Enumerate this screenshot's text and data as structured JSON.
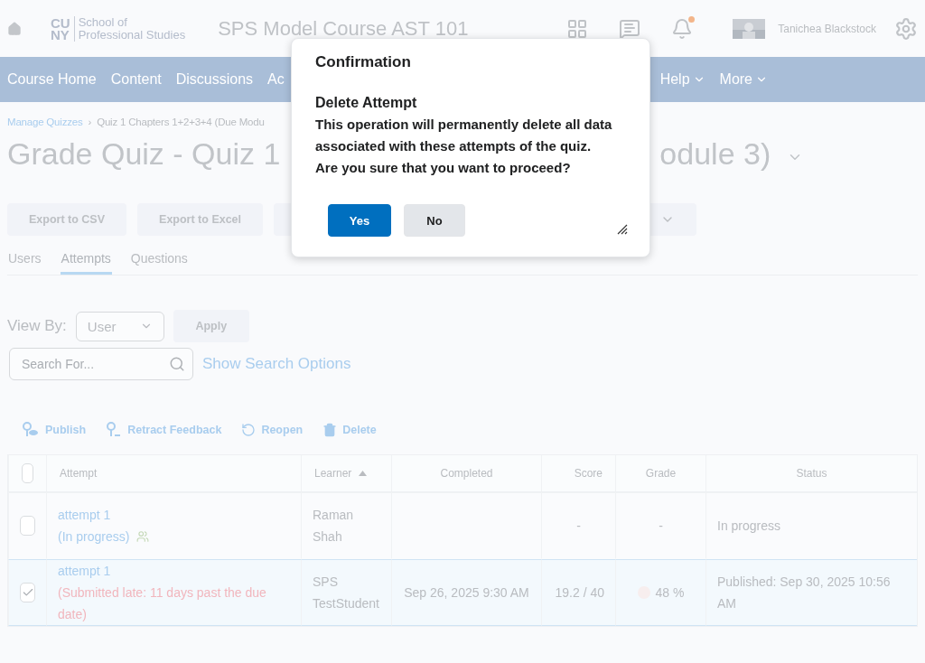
{
  "header": {
    "logo_mark_top": "CU",
    "logo_mark_bottom": "NY",
    "logo_line_1": "School of",
    "logo_line_2": "Professional Studies",
    "course_title": "SPS Model Course AST 101",
    "notification_dot": true,
    "user_name": "Tanichea Blackstock"
  },
  "nav": {
    "left_items": [
      {
        "label": "Course Home"
      },
      {
        "label": "Content"
      },
      {
        "label": "Discussions"
      },
      {
        "label": "Ac"
      }
    ],
    "right_items": [
      {
        "label": "Help",
        "has_menu": true
      },
      {
        "label": "More",
        "has_menu": true
      }
    ]
  },
  "breadcrumb": {
    "link": "Manage Quizzes",
    "separator": "›",
    "current": "Quiz 1 Chapters 1+2+3+4 (Due Modu"
  },
  "title": {
    "left": "Grade Quiz - Quiz 1",
    "right": "odule 3)"
  },
  "toolbar_buttons": [
    {
      "label": "Export to CSV",
      "kind": "text"
    },
    {
      "label": "Export to Excel",
      "kind": "text"
    },
    {
      "kind": "menu"
    }
  ],
  "tabs": [
    {
      "label": "Users",
      "selected": false
    },
    {
      "label": "Attempts",
      "selected": true
    },
    {
      "label": "Questions",
      "selected": false
    }
  ],
  "view_by": {
    "label": "View By:",
    "value": "User",
    "apply": "Apply"
  },
  "search": {
    "placeholder": "Search For...",
    "options_link": "Show Search Options"
  },
  "actions": [
    {
      "label": "Publish",
      "kind": "publish"
    },
    {
      "label": "Retract Feedback",
      "kind": "retract"
    },
    {
      "label": "Reopen",
      "kind": "reopen"
    },
    {
      "label": "Delete",
      "kind": "delete"
    }
  ],
  "table": {
    "select_all_checked": false,
    "columns": [
      {
        "label": "Attempt",
        "sorted": false
      },
      {
        "label": "Learner",
        "sorted": true
      },
      {
        "label": "Completed",
        "sorted": false
      },
      {
        "label": "Score",
        "sorted": false
      },
      {
        "label": "Grade",
        "sorted": false
      },
      {
        "label": "Status",
        "sorted": false
      }
    ],
    "rows": [
      {
        "selected": false,
        "checked": false,
        "attempt": "attempt 1",
        "note": "(In progress)",
        "late": false,
        "learner": "Raman Shah",
        "score": "-",
        "grade": "-",
        "grade_icon": false,
        "status": "In progress"
      },
      {
        "selected": true,
        "checked": true,
        "attempt": "attempt 1",
        "note": "(Submitted late: 11 days past the due date)",
        "late": true,
        "learner": "SPS TestStudent",
        "completed": "Sep 26, 2025 9:30 AM",
        "score": "19.2 / 40",
        "grade": "48 %",
        "grade_icon": true,
        "status": "Published: Sep 30, 2025 10:56 AM"
      }
    ]
  },
  "dialog": {
    "title": "Confirmation",
    "heading": "Delete Attempt",
    "lines": [
      "This operation will permanently delete all data",
      "associated with these attempts of the quiz.",
      "Are you sure that you want to proceed?"
    ],
    "buttons": [
      {
        "label": "Yes",
        "primary": true
      },
      {
        "label": "No",
        "primary": false
      }
    ]
  }
}
